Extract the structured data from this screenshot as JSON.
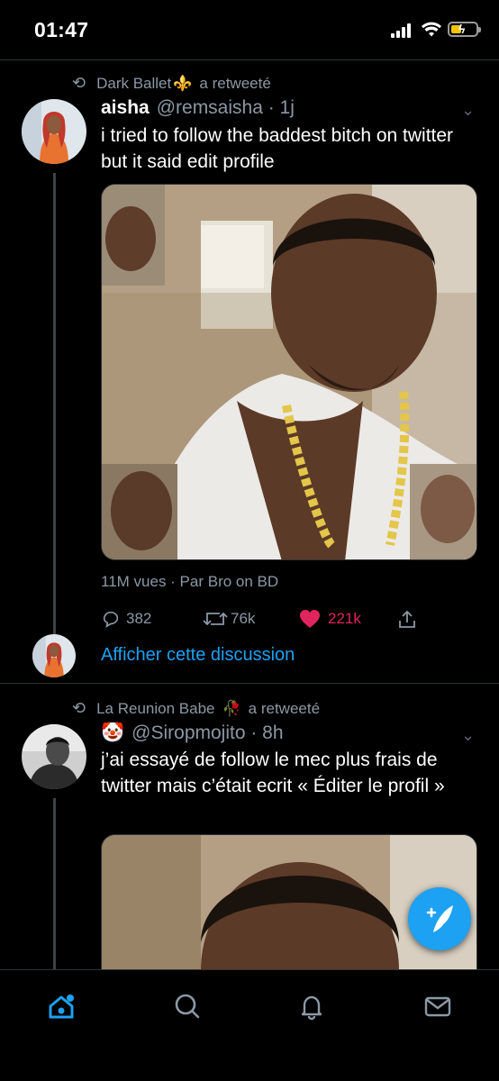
{
  "status_bar": {
    "time": "01:47",
    "icons": [
      "cellular-signal-icon",
      "wifi-icon",
      "battery-charging-icon"
    ]
  },
  "tweets": [
    {
      "retweeted_by": "Dark Ballet",
      "retweeted_by_emoji": "⚜️",
      "retweet_suffix": "a retweeté",
      "display_name": "aisha",
      "handle_time": "@remsaisha · 1j",
      "text": "i tried to follow the baddest bitch on twitter but it said edit profile",
      "views": "11M vues · Par Bro on BD",
      "replies": "382",
      "retweets": "76k",
      "likes": "221k",
      "liked": true
    },
    {
      "retweeted_by": "La Reunion Babe",
      "retweeted_by_emoji": "🥀",
      "retweet_suffix": "a retweeté",
      "display_name": "🤡",
      "handle_time": "@Siropmojito · 8h",
      "text": "j’ai essayé de follow le mec plus frais de twitter mais c’était ecrit « Éditer le profil »"
    }
  ],
  "show_thread": "Afficher cette discussion",
  "colors": {
    "background": "#000000",
    "accent": "#1da1f2",
    "like": "#e0245e",
    "secondary_text": "#8b98a5",
    "divider": "#2f3336"
  },
  "tab_bar": [
    "home-icon",
    "search-icon",
    "notifications-icon",
    "messages-icon"
  ],
  "fab_icon": "compose-tweet-icon"
}
